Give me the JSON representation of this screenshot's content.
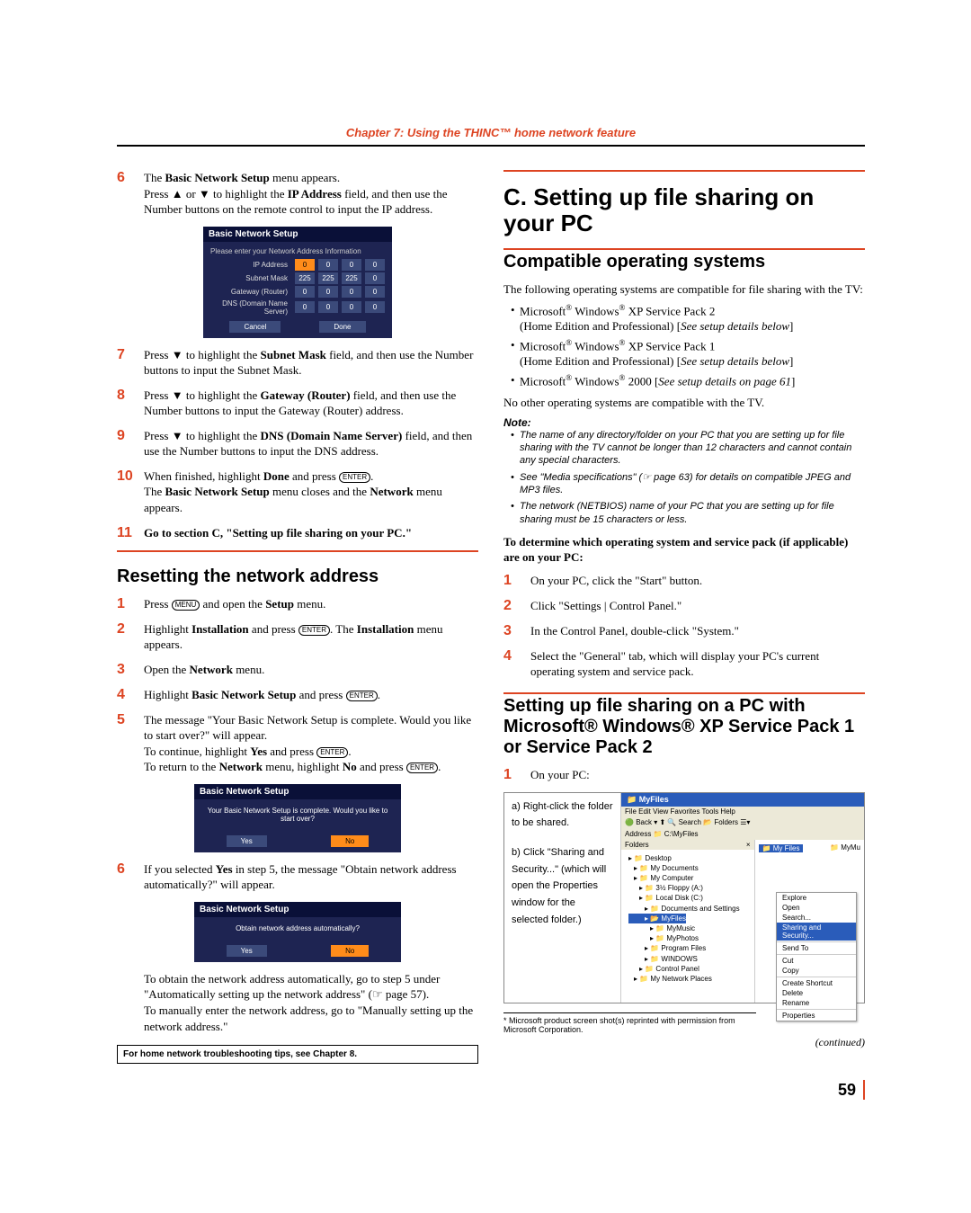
{
  "chapter_header": "Chapter 7: Using the THINC™ home network feature",
  "left": {
    "step6": {
      "num": "6",
      "line1a": "The ",
      "line1b": "Basic Network Setup",
      "line1c": " menu appears.",
      "line2a": "Press ",
      "line2b": " or ",
      "line2c": " to highlight the ",
      "line2d": "IP Address",
      "line2e": " field, and then use the Number buttons on the remote control to input the IP address."
    },
    "dialog1": {
      "title": "Basic Network Setup",
      "subhead": "Please enter your Network Address Information",
      "rows": {
        "ip": {
          "label": "IP Address",
          "vals": [
            "0",
            "0",
            "0",
            "0"
          ]
        },
        "mask": {
          "label": "Subnet Mask",
          "vals": [
            "225",
            "225",
            "225",
            "0"
          ]
        },
        "gw": {
          "label": "Gateway (Router)",
          "vals": [
            "0",
            "0",
            "0",
            "0"
          ]
        },
        "dns": {
          "label": "DNS (Domain Name Server)",
          "vals": [
            "0",
            "0",
            "0",
            "0"
          ]
        }
      },
      "btn_cancel": "Cancel",
      "btn_done": "Done"
    },
    "step7": {
      "num": "7",
      "a": "Press ",
      "b": " to highlight the ",
      "c": "Subnet Mask",
      "d": " field, and then use the Number buttons to input the Subnet Mask."
    },
    "step8": {
      "num": "8",
      "a": "Press ",
      "b": " to highlight the ",
      "c": "Gateway (Router)",
      "d": " field, and then use the Number buttons to input the Gateway (Router) address."
    },
    "step9": {
      "num": "9",
      "a": "Press ",
      "b": " to highlight the ",
      "c": "DNS (Domain Name Server)",
      "d": " field, and then use the Number buttons to input the DNS address."
    },
    "step10": {
      "num": "10",
      "a": "When finished, highlight ",
      "b": "Done",
      "c": " and press ",
      "d": ".",
      "e": "The ",
      "f": "Basic Network Setup",
      "g": " menu closes and the ",
      "h": "Network",
      "i": " menu appears."
    },
    "step11": {
      "num": "11",
      "a": "Go to section C, \"Setting up file sharing on your PC.\""
    },
    "reset_heading": "Resetting the network address",
    "r1": {
      "num": "1",
      "a": "Press ",
      "b": " and open the ",
      "c": "Setup",
      "d": " menu."
    },
    "r2": {
      "num": "2",
      "a": "Highlight ",
      "b": "Installation",
      "c": " and press ",
      "d": ". The ",
      "e": "Installation",
      "f": " menu appears."
    },
    "r3": {
      "num": "3",
      "a": "Open the ",
      "b": "Network",
      "c": " menu."
    },
    "r4": {
      "num": "4",
      "a": "Highlight ",
      "b": "Basic Network Setup",
      "c": " and press ",
      "d": "."
    },
    "r5": {
      "num": "5",
      "a": "The message \"Your Basic Network Setup is complete. Would you like to start over?\" will appear.",
      "b": "To continue, highlight ",
      "c": "Yes",
      "d": " and press ",
      "e": ".",
      "f": "To return to the ",
      "g": "Network",
      "h": " menu, highlight ",
      "i": "No",
      "j": " and press ",
      "k": "."
    },
    "dialog2": {
      "title": "Basic Network Setup",
      "msg": "Your Basic Network Setup is complete. Would you like to start over?",
      "yes": "Yes",
      "no": "No"
    },
    "r6": {
      "num": "6",
      "a": "If you selected ",
      "b": "Yes",
      "c": " in step 5, the message \"Obtain network address automatically?\" will appear."
    },
    "dialog3": {
      "title": "Basic Network Setup",
      "msg": "Obtain network address automatically?",
      "yes": "Yes",
      "no": "No"
    },
    "r6b": {
      "a": "To obtain the network address automatically, go to step 5 under \"Automatically setting up the network address\" (",
      "b": " page 57).",
      "c": "To manually enter the network address, go to \"Manually setting up the network address.\""
    },
    "tipbox": "For home network troubleshooting tips, see Chapter 8."
  },
  "right": {
    "h1": "C. Setting up file sharing on your PC",
    "h2a": "Compatible operating systems",
    "intro": "The following operating systems are compatible for file sharing with the TV:",
    "os1a": "Microsoft",
    "os1b": " Windows",
    "os1c": " XP Service Pack 2",
    "os1d": "(Home Edition and Professional) [",
    "os1e": "See setup details below",
    "os1f": "]",
    "os2a": "Microsoft",
    "os2b": " Windows",
    "os2c": " XP Service Pack 1",
    "os2d": "(Home Edition and Professional) [",
    "os2e": "See setup details below",
    "os2f": "]",
    "os3a": "Microsoft",
    "os3b": " Windows",
    "os3c": " 2000 [",
    "os3d": "See setup details on page 61",
    "os3e": "]",
    "noother": "No other operating systems are compatible with the TV.",
    "notehead": "Note:",
    "note1": "The name of any directory/folder on your PC that you are setting up for file sharing with the TV cannot be longer than 12 characters and cannot contain any special characters.",
    "note2a": "See \"Media specifications\" (",
    "note2b": " page 63) for details on compatible JPEG and MP3 files.",
    "note3": "The network (NETBIOS) name of your PC that you are setting up for file sharing must be 15 characters or less.",
    "determine": "To determine which operating system and service pack (if applicable) are on your PC:",
    "d1": {
      "num": "1",
      "t": "On your PC, click the \"Start\" button."
    },
    "d2": {
      "num": "2",
      "t": "Click \"Settings | Control Panel.\""
    },
    "d3": {
      "num": "3",
      "t": "In the Control Panel, double-click \"System.\""
    },
    "d4": {
      "num": "4",
      "t": "Select the \"General\" tab, which will display your PC's current operating system and service pack."
    },
    "h2b": "Setting up file sharing on a PC with Microsoft® Windows® XP Service Pack 1 or Service Pack 2",
    "s1": {
      "num": "1",
      "t": "On your PC:"
    },
    "shot": {
      "a_label": "a) Right-click the folder to be shared.",
      "b_label": "b) Click \"Sharing and Security...\" (which will open the Properties window for the selected folder.)",
      "wintitle": "MyFiles",
      "menubar": "File   Edit   View   Favorites   Tools   Help",
      "back": "Back",
      "search": "Search",
      "folders_btn": "Folders",
      "addrlbl": "Address",
      "addrval": "C:\\MyFiles",
      "folders": "Folders",
      "selected": "My Files",
      "tree": [
        "Desktop",
        " My Documents",
        " My Computer",
        "  3½ Floppy (A:)",
        "  Local Disk (C:)",
        "   Documents and Settings",
        "   MyFiles",
        "    MyMusic",
        "    MyPhotos",
        "   Program Files",
        "   WINDOWS",
        "  Control Panel",
        " My Network Places"
      ],
      "ctx": [
        "Explore",
        "Open",
        "Search...",
        "Sharing and Security...",
        "Send To",
        "Cut",
        "Copy",
        "Create Shortcut",
        "Delete",
        "Rename",
        "Properties"
      ],
      "ctx_hl": "Sharing and Security...",
      "mymu": "MyMu"
    },
    "footnote": "*  Microsoft product screen shot(s) reprinted with permission from Microsoft Corporation.",
    "continued": "(continued)"
  },
  "icons": {
    "up": "▲",
    "down": "▼",
    "enter": "ENTER",
    "menu": "MENU",
    "pointer": "☞"
  },
  "pagenum": "59"
}
